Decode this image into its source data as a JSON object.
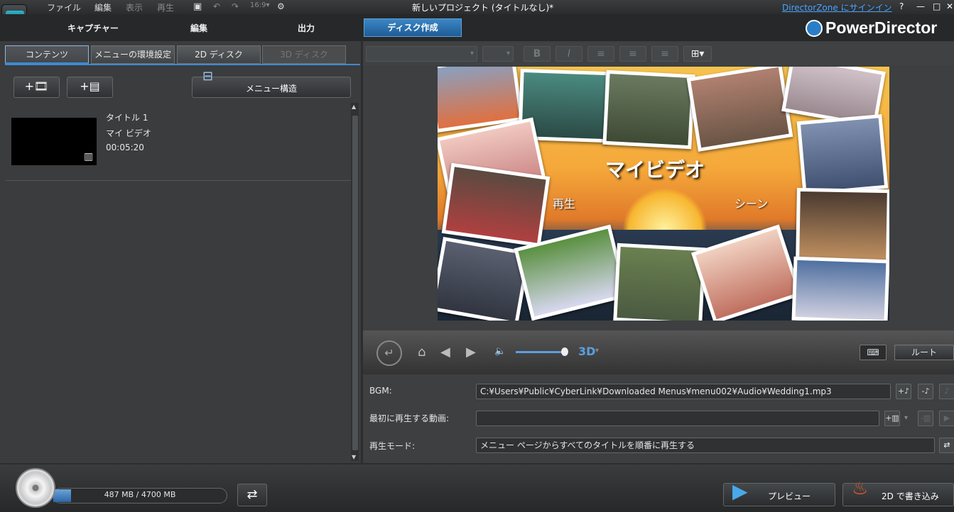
{
  "menu": {
    "file": "ファイル",
    "edit": "編集",
    "view": "表示",
    "play": "再生"
  },
  "window_title": "新しいプロジェクト (タイトルなし)*",
  "directorzone": "DirectorZone にサインイン",
  "help": "?",
  "tabs": {
    "capture": "キャプチャー",
    "edit": "編集",
    "output": "出力",
    "disc": "ディスク作成"
  },
  "brand": "PowerDirector",
  "subtabs": {
    "contents": "コンテンツ",
    "menu_settings": "メニューの環境設定",
    "disc2d": "2D ディスク",
    "disc3d": "3D ディスク"
  },
  "menu_structure": "メニュー構造",
  "title_item": {
    "name": "タイトル 1",
    "video": "マイ ビデオ",
    "duration": "00:05:20"
  },
  "preview_menu": {
    "title": "マイビデオ",
    "play": "再生",
    "scene": "シーン"
  },
  "root_button": "ルート",
  "three_d": "3D",
  "props": {
    "bgm_label": "BGM:",
    "bgm_value": "C:¥Users¥Public¥CyberLink¥Downloaded Menus¥menu002¥Audio¥Wedding1.mp3",
    "first_play_label": "最初に再生する動画:",
    "first_play_value": "",
    "mode_label": "再生モード:",
    "mode_value": "メニュー ページからすべてのタイトルを順番に再生する"
  },
  "capacity": {
    "text": "487 MB / 4700 MB",
    "used_fraction": 0.1036
  },
  "preview_button": "プレビュー",
  "burn_button": "2D で書き込み",
  "colors": {
    "accent": "#3c86c5",
    "active_tab_border": "#3f8ad0"
  }
}
